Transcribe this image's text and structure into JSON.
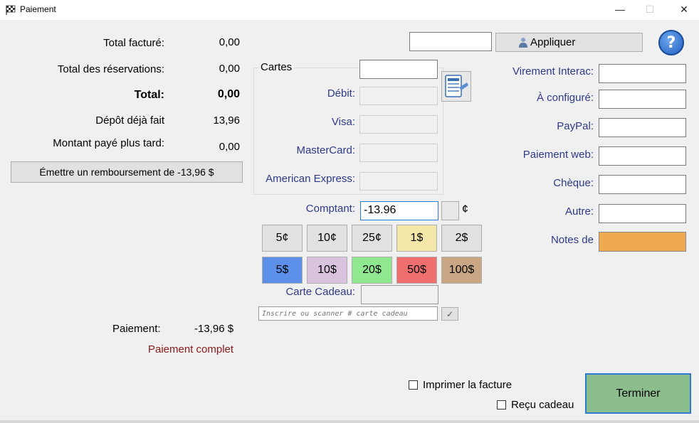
{
  "window": {
    "title": "Paiement",
    "minimize": "—",
    "maximize": "☐",
    "close": "✕"
  },
  "summary": {
    "total_invoiced_label": "Total facturé:",
    "total_invoiced_value": "0,00",
    "total_reservations_label": "Total des réservations:",
    "total_reservations_value": "0,00",
    "total_label": "Total:",
    "total_value": "0,00",
    "deposit_label": "Dépôt déjà fait",
    "deposit_value": "13,96",
    "later_label": "Montant payé plus tard:",
    "later_value": "0,00",
    "refund_button": "Émettre un remboursement de -13,96 $"
  },
  "apply": {
    "button_label": "Appliquer",
    "input_value": ""
  },
  "cards": {
    "group_label": "Cartes",
    "debit_label": "Débit:",
    "visa_label": "Visa:",
    "mastercard_label": "MasterCard:",
    "amex_label": "American Express:"
  },
  "cash": {
    "label": "Comptant:",
    "value": "-13.96",
    "cent_symbol": "¢"
  },
  "denominations": {
    "row1": [
      {
        "label": "5¢",
        "color": "#e1e1e1"
      },
      {
        "label": "10¢",
        "color": "#e1e1e1"
      },
      {
        "label": "25¢",
        "color": "#e1e1e1"
      },
      {
        "label": "1$",
        "color": "#f5e6aa"
      },
      {
        "label": "2$",
        "color": "#e1e1e1"
      }
    ],
    "row2": [
      {
        "label": "5$",
        "color": "#5b8fe8"
      },
      {
        "label": "10$",
        "color": "#d9c3df"
      },
      {
        "label": "20$",
        "color": "#8fe88f"
      },
      {
        "label": "50$",
        "color": "#ef6f6f"
      },
      {
        "label": "100$",
        "color": "#c9a784"
      }
    ]
  },
  "gift_card": {
    "label": "Carte Cadeau:",
    "placeholder": "Inscrire ou scanner # carte cadeau",
    "ok_symbol": "✓"
  },
  "payment": {
    "label": "Paiement:",
    "value": "-13,96 $",
    "status": "Paiement complet"
  },
  "other_methods": {
    "interac_label": "Virement Interac:",
    "configure_label": "À configuré:",
    "paypal_label": "PayPal:",
    "web_label": "Paiement web:",
    "cheque_label": "Chèque:",
    "other_label": "Autre:",
    "notes_label": "Notes de",
    "notes_color": "#efaa4f"
  },
  "footer": {
    "print_invoice_label": "Imprimer la facture",
    "gift_receipt_label": "Reçu cadeau",
    "finish_button": "Terminer"
  },
  "help_symbol": "?"
}
